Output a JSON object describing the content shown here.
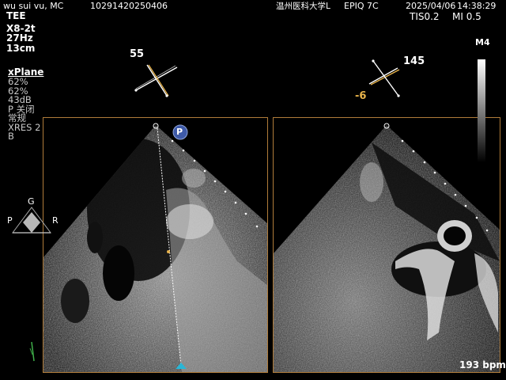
{
  "header": {
    "patient_name": "wu sui vu, MC",
    "patient_id": "10291420250406",
    "hospital": "温州医科大学L",
    "system": "EPIQ 7C",
    "date": "2025/04/06",
    "time": "14:38:29"
  },
  "indices": {
    "tis": "TIS0.2",
    "mi": "MI 0.5"
  },
  "probe": {
    "mode": "TEE",
    "transducer": "X8-2t",
    "frame_rate": "27Hz",
    "depth": "13cm"
  },
  "xplane": {
    "label": "xPlane",
    "gain1": "62%",
    "gain2": "62%",
    "dynamic_range": "43dB",
    "p_setting": "P 关闭",
    "preset": "常规",
    "xres": "XRES 2",
    "mode_b": "B"
  },
  "left_angle": {
    "value": "55"
  },
  "right_angle": {
    "value": "145",
    "tilt": "-6"
  },
  "colorbar": {
    "label": "M4"
  },
  "orientation": {
    "g": "G",
    "p": "P",
    "r": "R"
  },
  "marker": {
    "p": "P"
  },
  "heart_rate": "193 bpm"
}
